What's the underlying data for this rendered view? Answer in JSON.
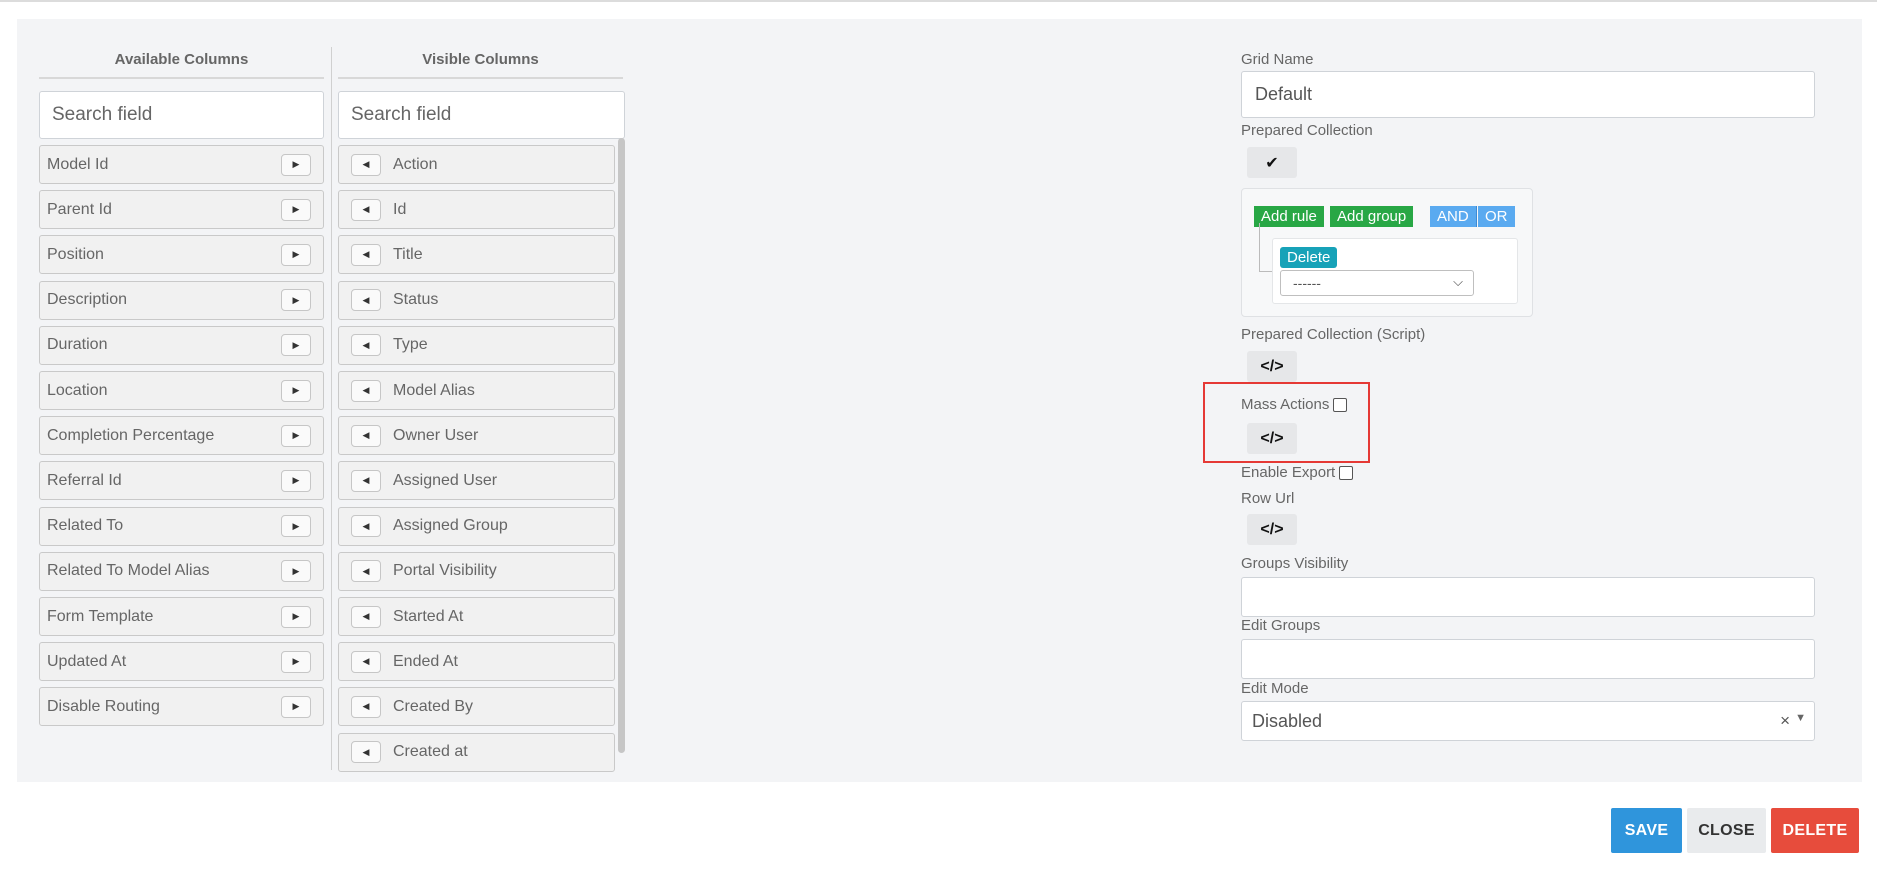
{
  "available_columns": {
    "header": "Available Columns",
    "search_placeholder": "Search field",
    "items": [
      "Model Id",
      "Parent Id",
      "Position",
      "Description",
      "Duration",
      "Location",
      "Completion Percentage",
      "Referral Id",
      "Related To",
      "Related To Model Alias",
      "Form Template",
      "Updated At",
      "Disable Routing"
    ]
  },
  "visible_columns": {
    "header": "Visible Columns",
    "search_placeholder": "Search field",
    "items": [
      "Action",
      "Id",
      "Title",
      "Status",
      "Type",
      "Model Alias",
      "Owner User",
      "Assigned User",
      "Assigned Group",
      "Portal Visibility",
      "Started At",
      "Ended At",
      "Created By",
      "Created at"
    ]
  },
  "settings": {
    "grid_name_label": "Grid Name",
    "grid_name_value": "Default",
    "prepared_collection_label": "Prepared Collection",
    "query_builder": {
      "add_rule": "Add rule",
      "add_group": "Add group",
      "and": "AND",
      "or": "OR",
      "delete": "Delete",
      "select_value": "------"
    },
    "prepared_collection_script_label": "Prepared Collection (Script)",
    "mass_actions_label": "Mass Actions",
    "enable_export_label": "Enable Export",
    "row_url_label": "Row Url",
    "groups_visibility_label": "Groups Visibility",
    "edit_groups_label": "Edit Groups",
    "edit_mode_label": "Edit Mode",
    "edit_mode_value": "Disabled",
    "code_icon_glyph": "</>",
    "check_icon_glyph": "✔"
  },
  "footer": {
    "save": "SAVE",
    "close": "CLOSE",
    "delete": "DELETE"
  },
  "colors": {
    "save": "#2f95dc",
    "close": "#e9ebed",
    "delete": "#e74c3c",
    "add_green": "#28a745",
    "and_or_blue": "#5aaaf0",
    "delete_teal": "#17a2b8",
    "highlight": "#e53935"
  }
}
